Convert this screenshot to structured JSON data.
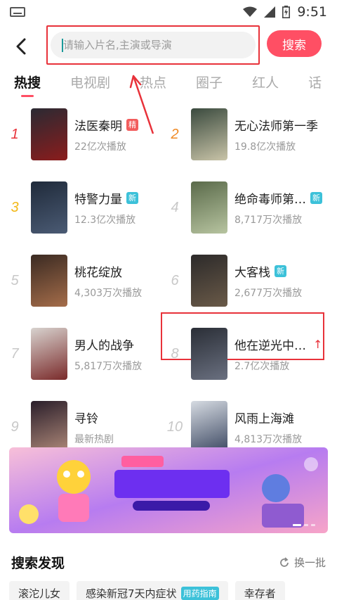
{
  "status_bar": {
    "time": "9:51"
  },
  "search": {
    "placeholder": "请输入片名,主演或导演",
    "button_label": "搜索"
  },
  "tabs": [
    {
      "label": "热搜",
      "active": true
    },
    {
      "label": "电视剧",
      "active": false
    },
    {
      "label": "热点",
      "active": false
    },
    {
      "label": "圈子",
      "active": false
    },
    {
      "label": "红人",
      "active": false
    },
    {
      "label": "话",
      "active": false
    }
  ],
  "hot_list": [
    {
      "rank": "1",
      "title": "法医秦明",
      "plays": "22亿次播放",
      "badge": "精",
      "badge_type": "jing"
    },
    {
      "rank": "2",
      "title": "无心法师第一季",
      "plays": "19.8亿次播放"
    },
    {
      "rank": "3",
      "title": "特警力量",
      "plays": "12.3亿次播放",
      "badge": "新",
      "badge_type": "xin"
    },
    {
      "rank": "4",
      "title": "绝命毒师第…",
      "plays": "8,717万次播放",
      "badge": "新",
      "badge_type": "xin"
    },
    {
      "rank": "5",
      "title": "桃花绽放",
      "plays": "4,303万次播放"
    },
    {
      "rank": "6",
      "title": "大客栈",
      "plays": "2,677万次播放",
      "badge": "新",
      "badge_type": "xin"
    },
    {
      "rank": "7",
      "title": "男人的战争",
      "plays": "5,817万次播放"
    },
    {
      "rank": "8",
      "title": "他在逆光中…",
      "plays": "2.7亿次播放",
      "trend": "↑"
    },
    {
      "rank": "9",
      "title": "寻铃",
      "plays": "最新热剧"
    },
    {
      "rank": "10",
      "title": "风雨上海滩",
      "plays": "4,813万次播放"
    }
  ],
  "discovery": {
    "title": "搜索发现",
    "refresh_label": "换一批",
    "chips": [
      {
        "label": "滚沱儿女"
      },
      {
        "label": "感染新冠7天内症状",
        "tag": "用药指南"
      },
      {
        "label": "幸存者"
      }
    ]
  },
  "colors": {
    "accent": "#ff4f64",
    "annotation": "#e8323a",
    "badge_new": "#3cc1d9",
    "badge_featured": "#f25c5c"
  }
}
